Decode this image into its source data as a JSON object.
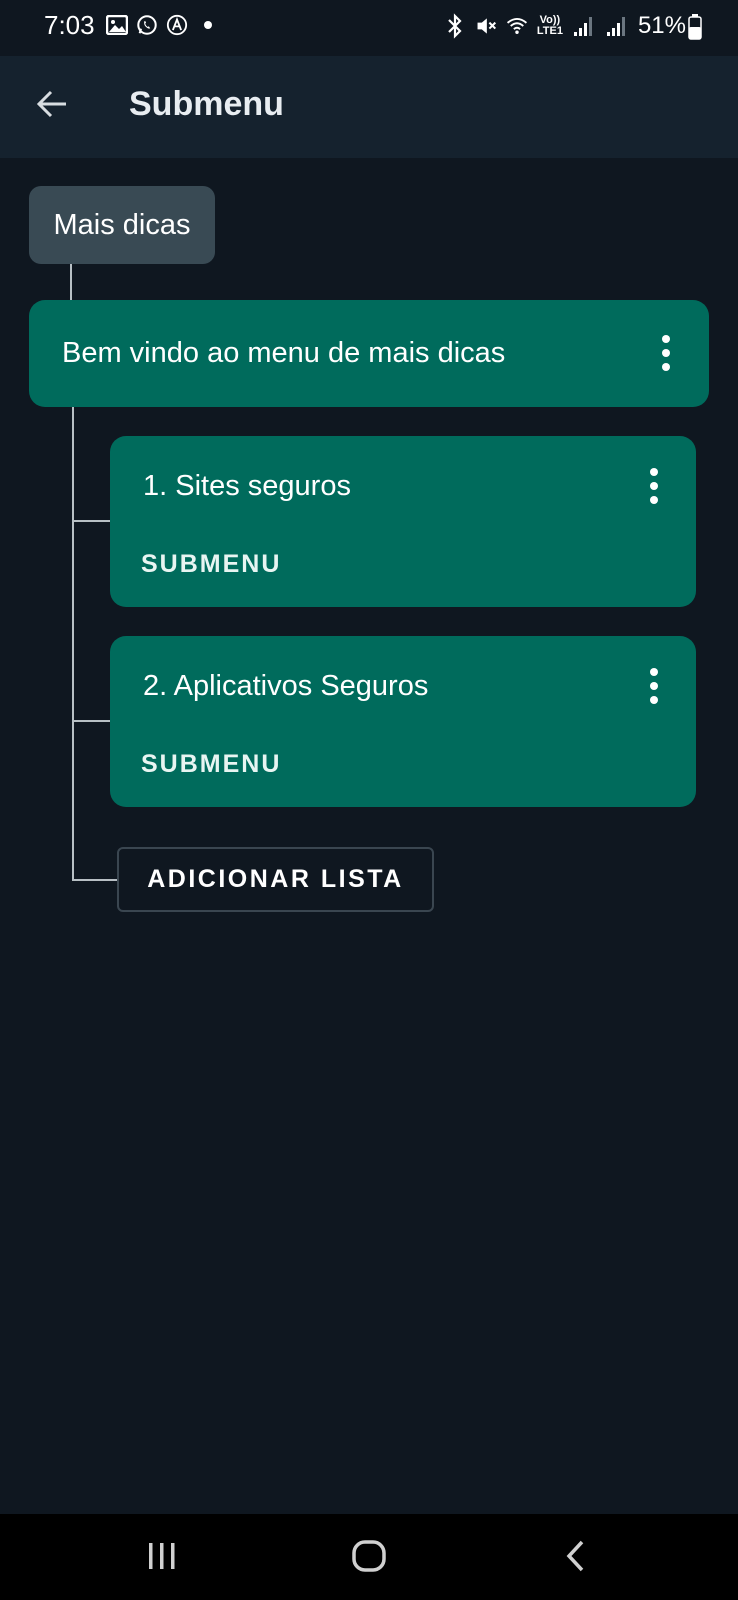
{
  "status_bar": {
    "time": "7:03",
    "battery_percent": "51%",
    "left_icons": [
      "gallery-icon",
      "whatsapp-icon",
      "a-circle-icon",
      "dot-icon"
    ],
    "right_icons": [
      "bluetooth-icon",
      "mute-icon",
      "wifi-icon",
      "volte-lte-icon",
      "signal-icon",
      "signal-icon-2",
      "battery-icon"
    ],
    "volte_label_top": "Vo))",
    "volte_label_bottom": "LTE1"
  },
  "app_bar": {
    "title": "Submenu",
    "back_icon": "arrow-back-icon"
  },
  "tree": {
    "root_label": "Mais dicas",
    "menu": {
      "label": "Bem vindo ao menu de mais dicas",
      "more_icon": "more-vert-icon"
    },
    "items": [
      {
        "title": "1. Sites seguros",
        "action": "SUBMENU"
      },
      {
        "title": "2. Aplicativos Seguros",
        "action": "SUBMENU"
      }
    ],
    "add_button": "ADICIONAR LISTA"
  },
  "colors": {
    "background": "#0f1720",
    "app_bar": "#15222e",
    "card": "#006b5c",
    "chip": "#394a54"
  },
  "nav_bar": {
    "buttons": [
      "recents-icon",
      "home-icon",
      "back-icon"
    ]
  }
}
